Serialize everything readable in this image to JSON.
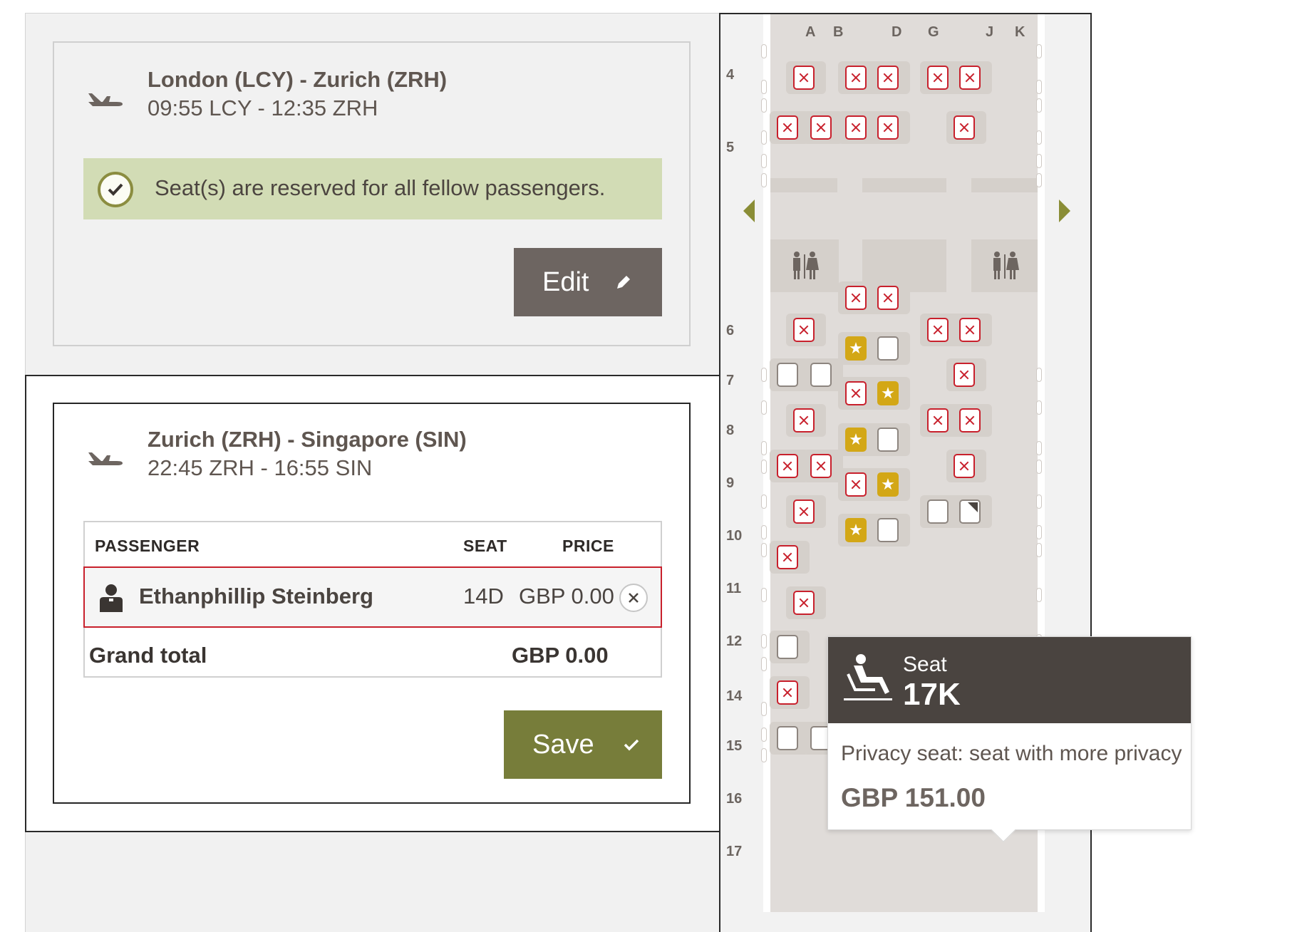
{
  "flights": [
    {
      "route": "London (LCY) - Zurich (ZRH)",
      "times": "09:55 LCY - 12:35 ZRH",
      "notice": "Seat(s) are reserved for all fellow passengers.",
      "edit_label": "Edit"
    },
    {
      "route": "Zurich (ZRH) - Singapore (SIN)",
      "times": "22:45 ZRH - 16:55 SIN",
      "table": {
        "headers": {
          "passenger": "PASSENGER",
          "seat": "SEAT",
          "price": "PRICE"
        },
        "rows": [
          {
            "name": "Ethanphillip Steinberg",
            "seat": "14D",
            "price": "GBP 0.00"
          }
        ],
        "grand_total_label": "Grand total",
        "grand_total_value": "GBP 0.00"
      },
      "save_label": "Save"
    }
  ],
  "seatmap": {
    "columns": [
      "A",
      "B",
      "D",
      "G",
      "J",
      "K"
    ],
    "rows": [
      "4",
      "5",
      "6",
      "7",
      "8",
      "9",
      "10",
      "11",
      "12",
      "14",
      "15",
      "16",
      "17"
    ],
    "legend_colors": {
      "occupied": "#c8202c",
      "premium": "#d3a716",
      "selected": "#3c7aa2"
    },
    "icons": [
      "toilet-icon",
      "star-icon",
      "reclined-seat-icon",
      "person-icon",
      "airplane-icon"
    ]
  },
  "tooltip": {
    "label": "Seat",
    "seat": "17K",
    "description": "Privacy seat: seat with more privacy",
    "price": "GBP 151.00"
  }
}
